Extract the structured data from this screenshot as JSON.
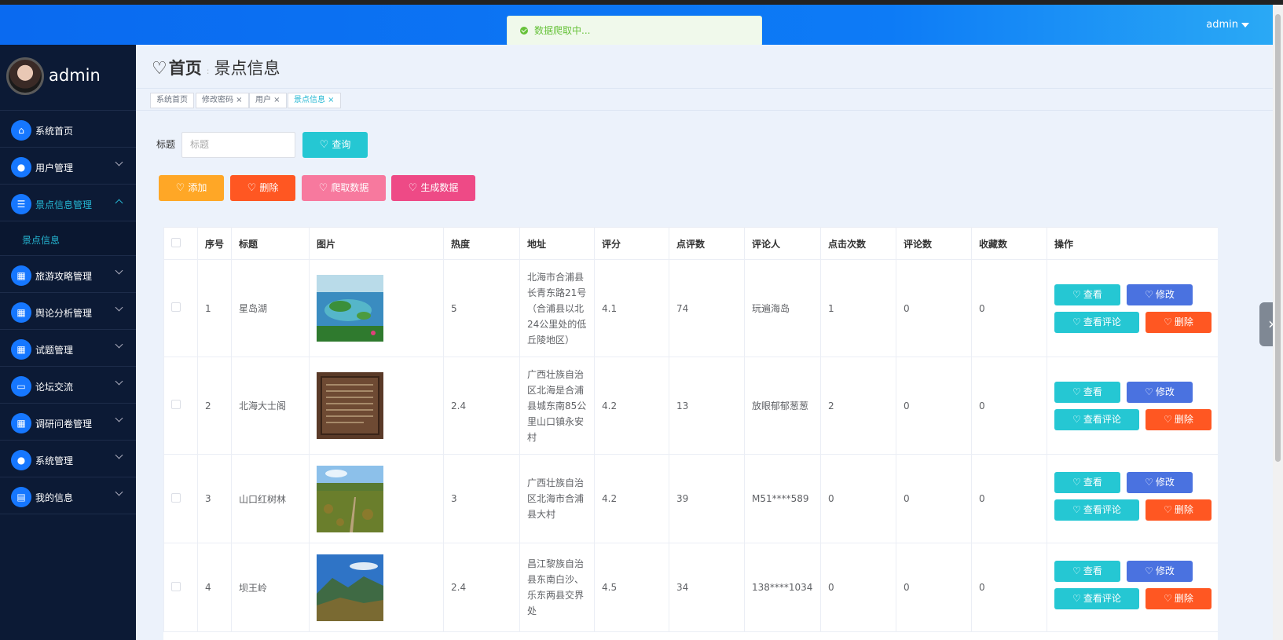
{
  "topbar": {
    "user": "admin"
  },
  "toast": {
    "message": "数据爬取中..."
  },
  "sidebar": {
    "username": "admin",
    "items": [
      {
        "label": "系统首页",
        "icon": "home-icon",
        "glyph": "⌂",
        "chevron": false
      },
      {
        "label": "用户管理",
        "icon": "user-icon",
        "glyph": "●",
        "chevron": true
      },
      {
        "label": "景点信息管理",
        "icon": "list-icon",
        "glyph": "☰",
        "chevron": true,
        "open": true
      },
      {
        "label": "旅游攻略管理",
        "icon": "grid-icon",
        "glyph": "▦",
        "chevron": true
      },
      {
        "label": "舆论分析管理",
        "icon": "grid-icon",
        "glyph": "▦",
        "chevron": true
      },
      {
        "label": "试题管理",
        "icon": "grid-icon",
        "glyph": "▦",
        "chevron": true
      },
      {
        "label": "论坛交流",
        "icon": "ticket-icon",
        "glyph": "▭",
        "chevron": true
      },
      {
        "label": "调研问卷管理",
        "icon": "grid-icon",
        "glyph": "▦",
        "chevron": true
      },
      {
        "label": "系统管理",
        "icon": "user-icon",
        "glyph": "●",
        "chevron": true
      },
      {
        "label": "我的信息",
        "icon": "card-icon",
        "glyph": "▤",
        "chevron": true
      }
    ],
    "sub_item": "景点信息"
  },
  "breadcrumb": {
    "home": "首页",
    "separator": ":",
    "current": "景点信息"
  },
  "tags": [
    {
      "label": "系统首页",
      "closable": false
    },
    {
      "label": "修改密码",
      "closable": true
    },
    {
      "label": "用户",
      "closable": true
    },
    {
      "label": "景点信息",
      "closable": true,
      "active": true
    }
  ],
  "search": {
    "label": "标题",
    "placeholder": "标题",
    "button": "查询"
  },
  "actions": {
    "add": "添加",
    "delete": "删除",
    "crawl": "爬取数据",
    "generate": "生成数据"
  },
  "table": {
    "headers": [
      "序号",
      "标题",
      "图片",
      "热度",
      "地址",
      "评分",
      "点评数",
      "评论人",
      "点击次数",
      "评论数",
      "收藏数",
      "操作"
    ],
    "ops": {
      "view": "查看",
      "edit": "修改",
      "view_comments": "查看评论",
      "delete": "删除"
    },
    "rows": [
      {
        "no": "1",
        "title": "星岛湖",
        "heat": "5",
        "address": "北海市合浦县长青东路21号（合浦县以北24公里处的低丘陵地区）",
        "rating": "4.1",
        "reviews": "74",
        "reviewer": "玩遍海岛",
        "clicks": "1",
        "comments": "0",
        "favorites": "0"
      },
      {
        "no": "2",
        "title": "北海大士阁",
        "heat": "2.4",
        "address": "广西壮族自治区北海是合浦县城东南85公里山口镇永安村",
        "rating": "4.2",
        "reviews": "13",
        "reviewer": "放眼郁郁葱葱",
        "clicks": "2",
        "comments": "0",
        "favorites": "0"
      },
      {
        "no": "3",
        "title": "山口红树林",
        "heat": "3",
        "address": "广西壮族自治区北海市合浦县大村",
        "rating": "4.2",
        "reviews": "39",
        "reviewer": "M51****589",
        "clicks": "0",
        "comments": "0",
        "favorites": "0"
      },
      {
        "no": "4",
        "title": "坝王岭",
        "heat": "2.4",
        "address": "昌江黎族自治县东南白沙、乐东两县交界处",
        "rating": "4.5",
        "reviews": "34",
        "reviewer": "138****1034",
        "clicks": "0",
        "comments": "0",
        "favorites": "0"
      }
    ]
  },
  "colors": {
    "topbar": "#0a6af0",
    "sidebar": "#0c1a35",
    "accent": "#25b7d3",
    "btn_query": "#25c7d3",
    "btn_add": "#ffa726",
    "btn_delete": "#ff5722",
    "btn_crawl": "#f7799e",
    "btn_generate": "#ee4a86",
    "btn_edit": "#4a72e0"
  }
}
